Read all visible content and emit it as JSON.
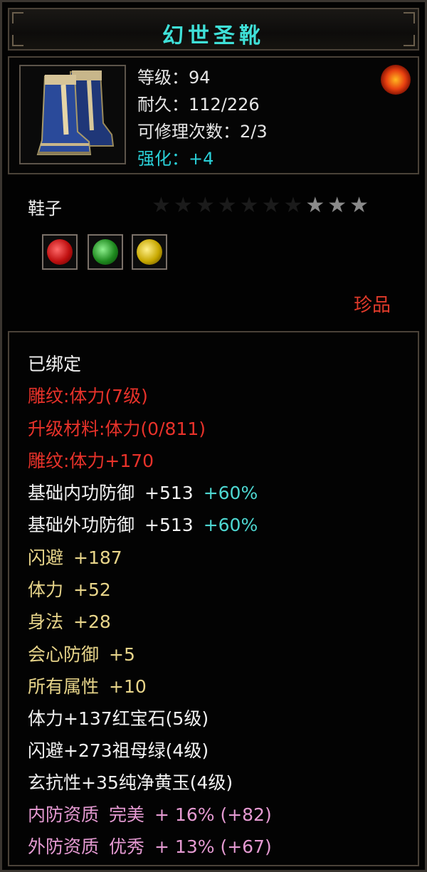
{
  "title": "幻世圣靴",
  "header": {
    "level": "等级：94",
    "durability": "耐久：112/226",
    "repairs": "可修理次数：2/3",
    "enhance": "强化：+4"
  },
  "item_type": "鞋子",
  "stars": {
    "filled": 3,
    "total": 10
  },
  "rarity": "珍品",
  "gems": [
    "red-gem",
    "green-gem",
    "yellow-gem"
  ],
  "stats": {
    "bound": "已绑定",
    "engrave1": "雕纹:体力(7级)",
    "upgrade_mat": "升级材料:体力(0/811)",
    "engrave2": "雕纹:体力+170",
    "base_inner_def_label": "基础内功防御",
    "base_inner_def_value": "+513",
    "base_inner_def_pct": "+60%",
    "base_outer_def_label": "基础外功防御",
    "base_outer_def_value": "+513",
    "base_outer_def_pct": "+60%",
    "dodge_label": "闪避",
    "dodge_value": "+187",
    "stamina_label": "体力",
    "stamina_value": "+52",
    "agility_label": "身法",
    "agility_value": "+28",
    "crit_def_label": "会心防御",
    "crit_def_value": "+5",
    "all_attr_label": "所有属性",
    "all_attr_value": "+10",
    "gem1": "体力+137红宝石(5级)",
    "gem2": "闪避+273祖母绿(4级)",
    "gem3": "玄抗性+35纯净黄玉(4级)",
    "inner_quality_label": "内防资质",
    "inner_quality_grade": "完美",
    "inner_quality_value": "+ 16% (+82)",
    "outer_quality_label": "外防资质",
    "outer_quality_grade": "优秀",
    "outer_quality_value": "+ 13% (+67)"
  }
}
